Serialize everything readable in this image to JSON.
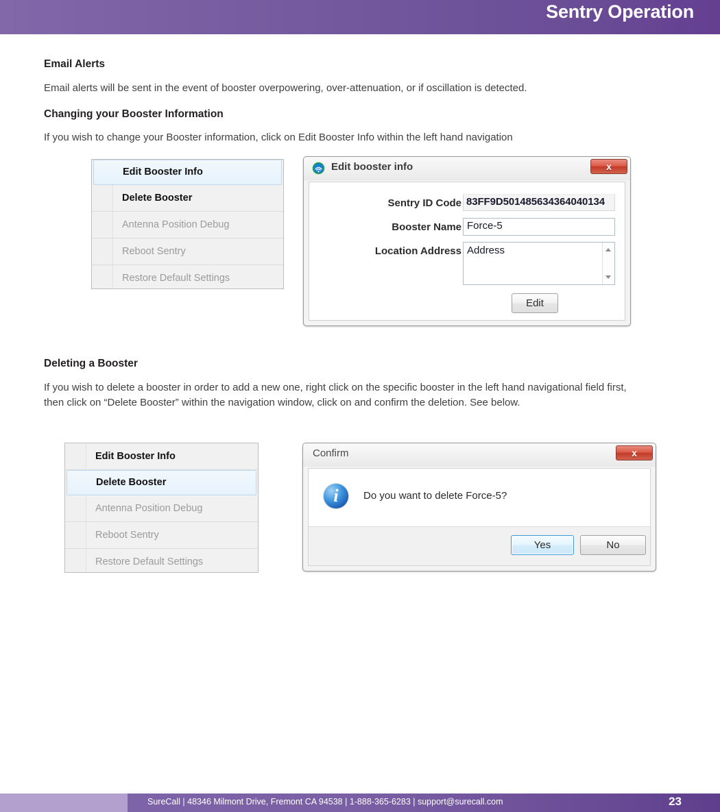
{
  "header": {
    "title": "Sentry Operation"
  },
  "sections": {
    "email_alerts": {
      "heading": "Email Alerts",
      "paragraph": "Email alerts will be sent in the event of booster overpowering, over-attenuation, or if oscillation is detected."
    },
    "changing_booster": {
      "heading": "Changing your Booster Information",
      "paragraph": "If you wish to change your Booster information, click on Edit Booster Info within the left hand navigation"
    },
    "deleting_booster": {
      "heading": "Deleting a Booster",
      "paragraph": "If you wish to delete a booster in order to add a new one, right click on the specific booster in the left hand navigational field first, then click on “Delete Booster” within the navigation window, click on and confirm the deletion. See below."
    }
  },
  "menu_one": {
    "items": [
      {
        "label": "Edit Booster Info",
        "state": "selected"
      },
      {
        "label": "Delete Booster",
        "state": "enabled"
      },
      {
        "label": "Antenna Position Debug",
        "state": "disabled"
      },
      {
        "label": "Reboot Sentry",
        "state": "disabled"
      },
      {
        "label": "Restore Default Settings",
        "state": "disabled"
      }
    ]
  },
  "menu_two": {
    "items": [
      {
        "label": "Edit Booster Info",
        "state": "enabled"
      },
      {
        "label": "Delete Booster",
        "state": "selected"
      },
      {
        "label": "Antenna Position Debug",
        "state": "disabled"
      },
      {
        "label": "Reboot Sentry",
        "state": "disabled"
      },
      {
        "label": "Restore Default Settings",
        "state": "disabled"
      }
    ]
  },
  "edit_dialog": {
    "title": "Edit booster info",
    "close_label": "x",
    "icon": "surecall-signal-icon",
    "fields": {
      "sentry_id_label": "Sentry ID Code",
      "sentry_id_value": "83FF9D501485634364040134",
      "booster_name_label": "Booster Name",
      "booster_name_value": "Force-5",
      "location_label": "Location Address",
      "location_value": "Address"
    },
    "edit_button": "Edit"
  },
  "confirm_dialog": {
    "title": "Confirm",
    "close_label": "x",
    "message": "Do you want to delete Force-5?",
    "yes_button": "Yes",
    "no_button": "No"
  },
  "footer": {
    "text": "SureCall | 48346 Milmont Drive, Fremont CA 94538 | 1-888-365-6283 | support@surecall.com",
    "page_number": "23"
  },
  "colors": {
    "header_purple_light": "#8268a9",
    "header_purple_dark": "#653f91",
    "footer_light_block": "#b3a0cf",
    "close_button_red": "#c23c28",
    "menu_selected_blue": "#e6f2fb"
  }
}
